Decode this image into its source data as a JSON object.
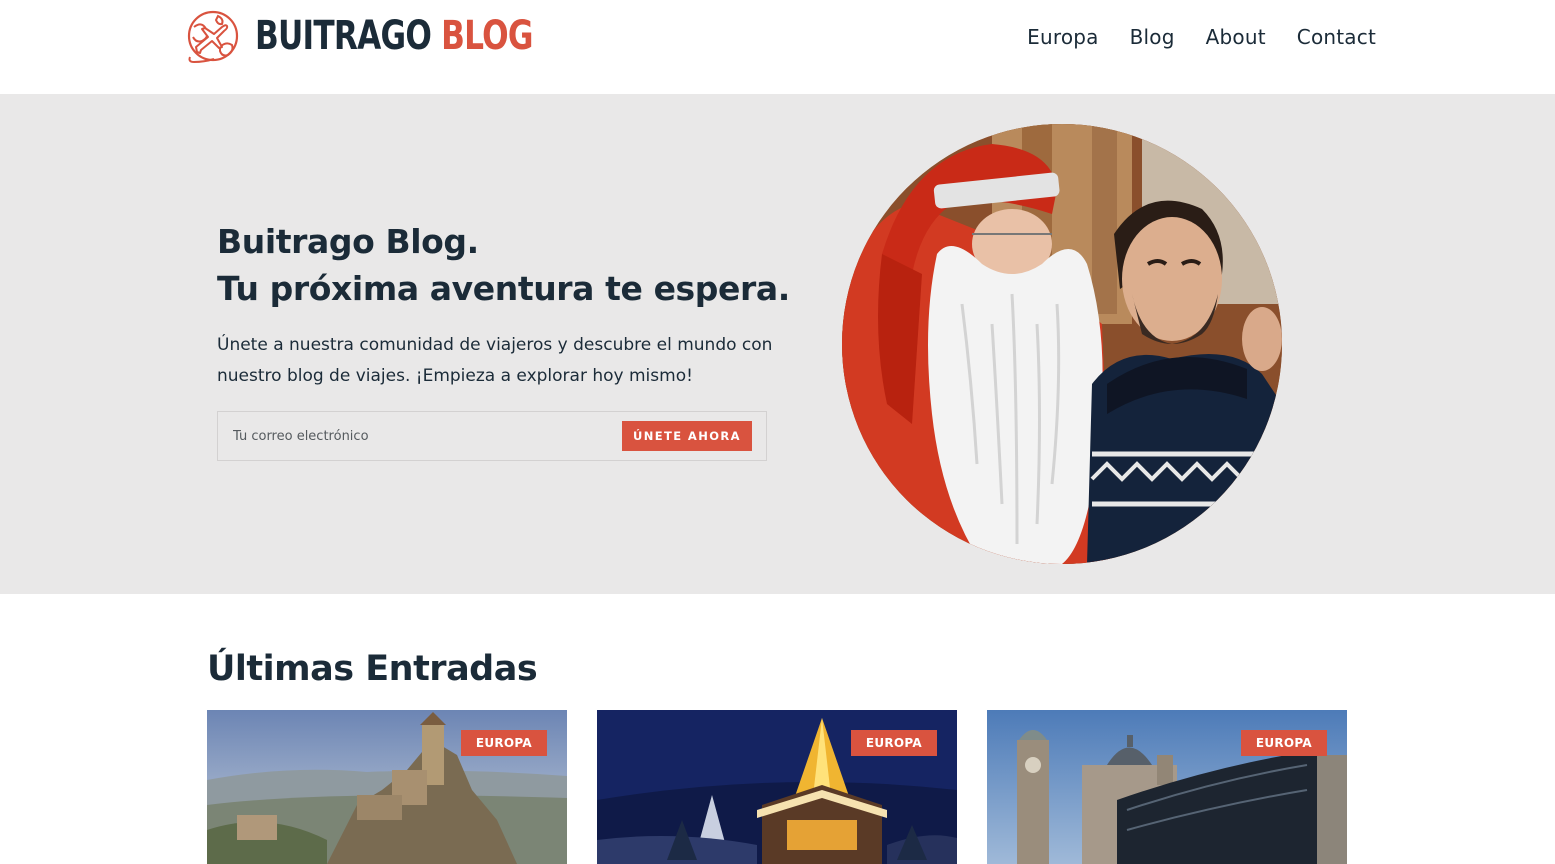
{
  "header": {
    "logo": {
      "word1": "BUITRAGO",
      "word2": "BLOG",
      "icon": "globe-airplane-icon"
    },
    "nav": [
      "Europa",
      "Blog",
      "About",
      "Contact"
    ]
  },
  "hero": {
    "title_line1": "Buitrago Blog.",
    "title_line2": "Tu próxima aventura te espera.",
    "description": "Únete a nuestra comunidad de viajeros y descubre el mundo con nuestro blog de viajes. ¡Empieza a explorar hoy mismo!",
    "email_placeholder": "Tu correo electrónico",
    "button_label": "ÚNETE AHORA",
    "photo": "santa-claus-and-traveler-photo"
  },
  "latest": {
    "title": "Últimas Entradas",
    "posts": [
      {
        "category": "EUROPA",
        "image": "san-marino-castle-photo"
      },
      {
        "category": "EUROPA",
        "image": "santa-claus-village-night-photo"
      },
      {
        "category": "EUROPA",
        "image": "liverpool-waterfront-photo"
      }
    ]
  },
  "colors": {
    "accent": "#d9533f",
    "dark": "#1b2b38",
    "hero_bg": "#e9e8e8"
  }
}
